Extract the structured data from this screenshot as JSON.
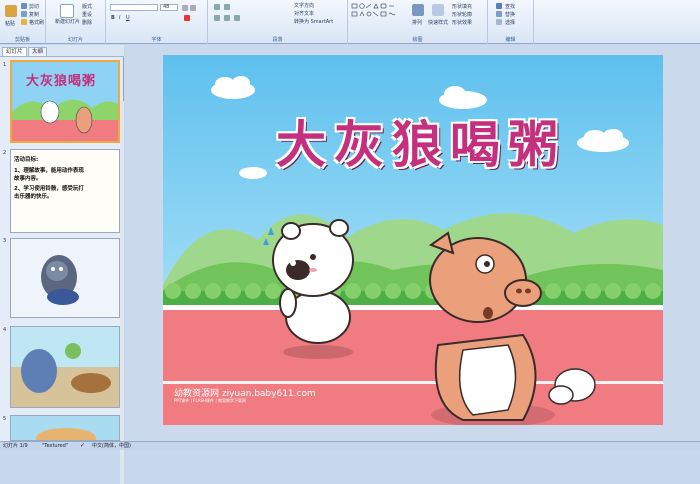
{
  "ribbon": {
    "clipboard": {
      "paste": "粘贴",
      "cut": "剪切",
      "copy": "复制",
      "format_painter": "格式刷",
      "label": "剪贴板"
    },
    "slides": {
      "new_slide": "新建幻灯片",
      "layout": "版式",
      "reset": "重设",
      "delete": "删除",
      "label": "幻灯片"
    },
    "font": {
      "size": "48",
      "label": "字体"
    },
    "paragraph": {
      "text_direction": "文字方向",
      "align_text": "对齐文本",
      "smartart": "转换为 SmartArt",
      "label": "段落"
    },
    "drawing": {
      "arrange": "排列",
      "quick_styles": "快速样式",
      "shape_fill": "形状填充",
      "shape_outline": "形状轮廓",
      "shape_effects": "形状效果",
      "label": "绘图"
    },
    "editing": {
      "find": "查找",
      "replace": "替换",
      "select": "选择",
      "label": "编辑"
    }
  },
  "panel": {
    "tabs": [
      "幻灯片",
      "大纲"
    ],
    "slide_numbers": [
      "1",
      "2",
      "3",
      "4",
      "5"
    ],
    "thumb1_title": "大灰狼喝粥",
    "thumb2_text": [
      "活动目标:",
      "1、理解故事，能用动作表现故事内容。",
      "2、学习使用铃鼓，感受玩打击乐器的快乐。"
    ]
  },
  "slide": {
    "title": "大灰狼喝粥",
    "watermark": "幼教资源网 ziyuan.baby611.com",
    "watermark_small": "PPT课件 | FLASH课件 | 教案教学下载网"
  },
  "status": {
    "slide_info": "幻灯片 1/9",
    "theme": "\"Textured\"",
    "language": "中文(简体，中国)"
  },
  "colors": {
    "sky": "#8fd3f4",
    "track": "#f07c82",
    "title": "#c4307d",
    "grass": "#8ed46a"
  }
}
